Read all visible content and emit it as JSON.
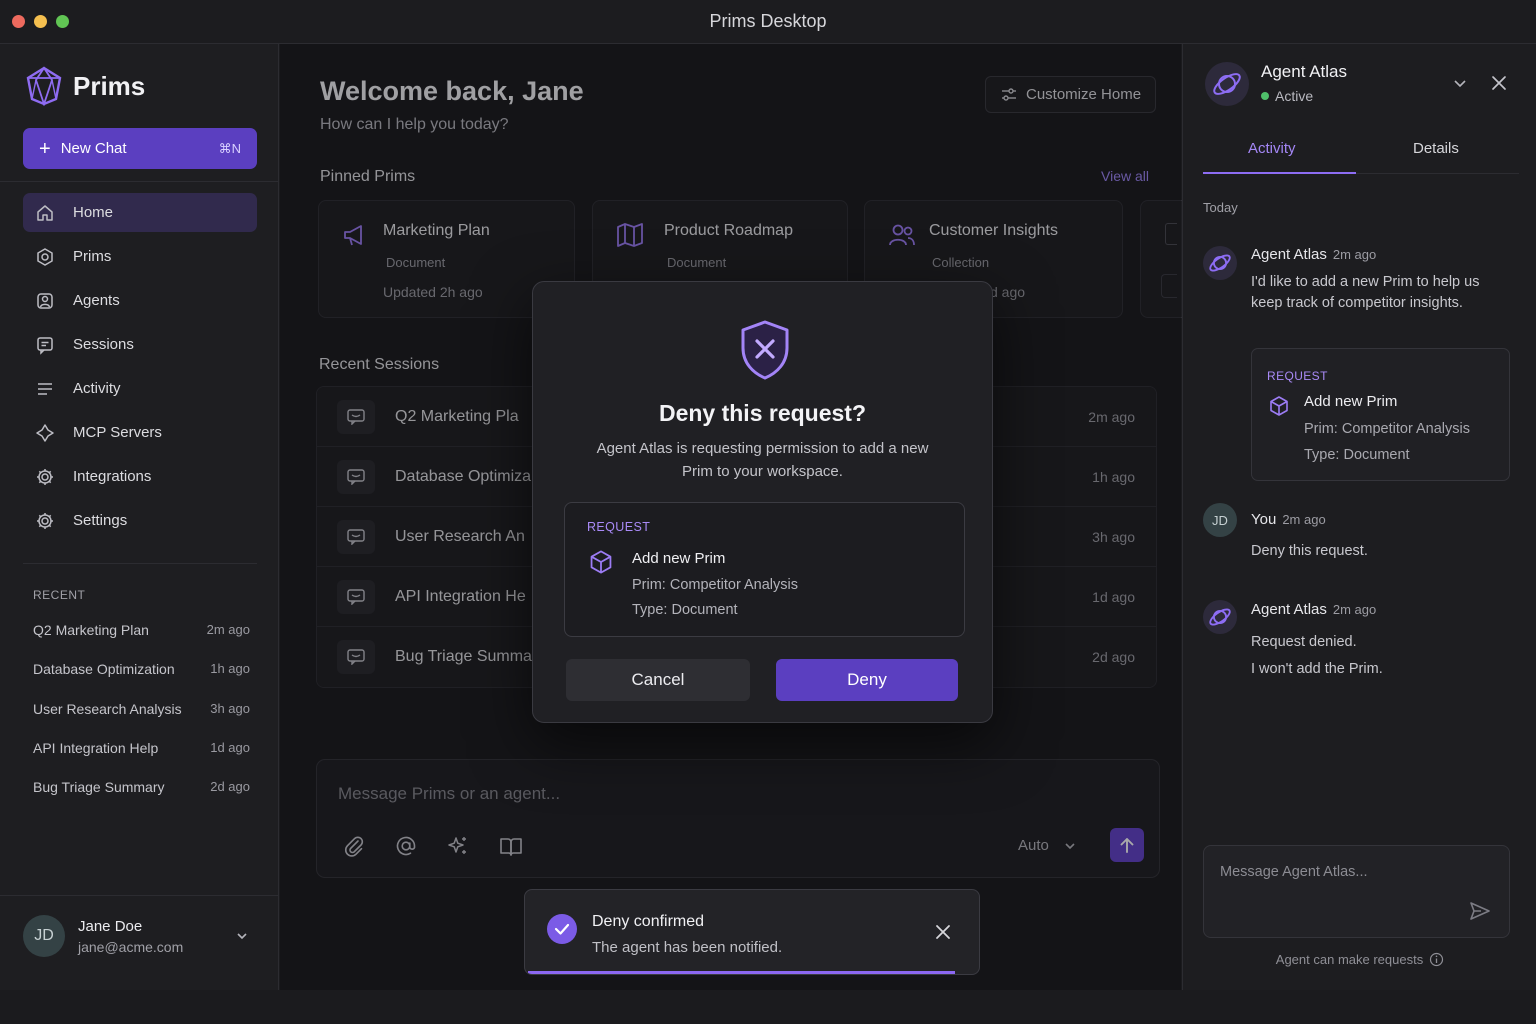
{
  "window": {
    "title": "Prims Desktop"
  },
  "sidebar": {
    "logo_text": "Prims",
    "new_chat": {
      "label": "New Chat",
      "shortcut": "⌘N"
    },
    "nav": [
      {
        "label": "Home",
        "icon": "home-icon",
        "active": true
      },
      {
        "label": "Prims",
        "icon": "hexagon-icon"
      },
      {
        "label": "Agents",
        "icon": "agent-icon"
      },
      {
        "label": "Sessions",
        "icon": "chat-icon"
      },
      {
        "label": "Activity",
        "icon": "list-icon"
      },
      {
        "label": "MCP Servers",
        "icon": "mcp-icon"
      },
      {
        "label": "Integrations",
        "icon": "gear-icon"
      },
      {
        "label": "Settings",
        "icon": "gear-icon"
      }
    ],
    "recent_heading": "RECENT",
    "recent": [
      {
        "title": "Q2 Marketing Plan",
        "time": "2m ago"
      },
      {
        "title": "Database Optimization",
        "time": "1h ago"
      },
      {
        "title": "User Research Analysis",
        "time": "3h ago"
      },
      {
        "title": "API Integration Help",
        "time": "1d ago"
      },
      {
        "title": "Bug Triage Summary",
        "time": "2d ago"
      }
    ],
    "user": {
      "initials": "JD",
      "name": "Jane Doe",
      "email": "jane@acme.com"
    }
  },
  "main": {
    "welcome": "Welcome back, Jane",
    "subtitle": "How can I help you today?",
    "customize_label": "Customize Home",
    "pinned_title": "Pinned Prims",
    "view_all": "View all",
    "pinned": [
      {
        "name": "Marketing Plan",
        "type": "Document",
        "updated": "Updated 2h ago",
        "icon": "megaphone-icon"
      },
      {
        "name": "Product Roadmap",
        "type": "Document",
        "updated": "",
        "icon": "map-icon"
      },
      {
        "name": "Customer Insights",
        "type": "Collection",
        "updated": "d ago",
        "icon": "users-icon"
      }
    ],
    "recent_title": "Recent Sessions",
    "sessions": [
      {
        "name": "Q2 Marketing Pla",
        "time": "2m ago"
      },
      {
        "name": "Database Optimiza",
        "time": "1h ago"
      },
      {
        "name": "User Research An",
        "time": "3h ago"
      },
      {
        "name": "API Integration He",
        "time": "1d ago"
      },
      {
        "name": "Bug Triage Summa",
        "time": "2d ago"
      }
    ],
    "composer": {
      "placeholder": "Message Prims or an agent...",
      "mode": "Auto"
    }
  },
  "modal": {
    "title": "Deny this request?",
    "description": "Agent Atlas is requesting permission to add a new Prim to your workspace.",
    "request_label": "REQUEST",
    "action": "Add new Prim",
    "prim_line": "Prim: Competitor Analysis",
    "type_line": "Type: Document",
    "cancel": "Cancel",
    "deny": "Deny"
  },
  "toast": {
    "title": "Deny confirmed",
    "message": "The agent has been notified."
  },
  "right_panel": {
    "agent_name": "Agent Atlas",
    "status": "Active",
    "tabs": [
      "Activity",
      "Details"
    ],
    "today": "Today",
    "messages": [
      {
        "author": "Agent Atlas",
        "time": "2m ago",
        "body": "I'd like to add a new Prim to help us keep track of competitor insights."
      },
      {
        "author": "You",
        "time": "2m ago",
        "initials": "JD",
        "body": "Deny this request."
      },
      {
        "author": "Agent Atlas",
        "time": "2m ago",
        "body_line1": "Request denied.",
        "body_line2": "I won't add the Prim."
      }
    ],
    "request": {
      "label": "REQUEST",
      "action": "Add new Prim",
      "prim_line": "Prim: Competitor Analysis",
      "type_line": "Type: Document"
    },
    "input_placeholder": "Message Agent Atlas...",
    "footer": "Agent can make requests"
  },
  "colors": {
    "accent": "#5b3fc0",
    "accent_light": "#9d85f5",
    "status_green": "#4fbf6a"
  }
}
